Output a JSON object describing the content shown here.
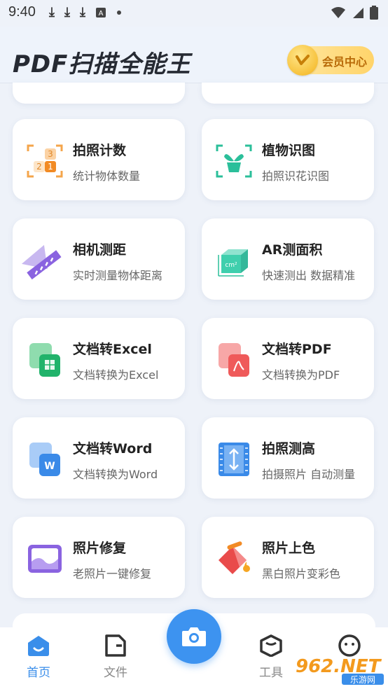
{
  "status_bar": {
    "time": "9:40"
  },
  "header": {
    "title": "PDF扫描全能王",
    "vip_label": "会员中心"
  },
  "tools": [
    {
      "title": "拍照计数",
      "subtitle": "统计物体数量",
      "icon": "photo-count-icon"
    },
    {
      "title": "植物识图",
      "subtitle": "拍照识花识图",
      "icon": "plant-icon"
    },
    {
      "title": "相机测距",
      "subtitle": "实时测量物体距离",
      "icon": "ruler-icon"
    },
    {
      "title": "AR测面积",
      "subtitle": "快速测出 数据精准",
      "icon": "ar-area-icon"
    },
    {
      "title": "文档转Excel",
      "subtitle": "文档转换为Excel",
      "icon": "excel-icon"
    },
    {
      "title": "文档转PDF",
      "subtitle": "文档转换为PDF",
      "icon": "pdf-icon"
    },
    {
      "title": "文档转Word",
      "subtitle": "文档转换为Word",
      "icon": "word-icon"
    },
    {
      "title": "拍照测高",
      "subtitle": "拍摄照片 自动测量",
      "icon": "height-icon"
    },
    {
      "title": "照片修复",
      "subtitle": "老照片一键修复",
      "icon": "photo-repair-icon"
    },
    {
      "title": "照片上色",
      "subtitle": "黑白照片变彩色",
      "icon": "colorize-icon"
    }
  ],
  "icon_labels": {
    "ar_unit": "cm²",
    "word_letter": "W",
    "count_3": "3",
    "count_2": "2",
    "count_1": "1"
  },
  "tabbar": {
    "home": "首页",
    "files": "文件",
    "tools": "工具"
  },
  "watermark": {
    "text": "962.NET",
    "sub": "乐游网"
  },
  "colors": {
    "accent": "#3d93f0",
    "vip": "#ffd46a"
  }
}
